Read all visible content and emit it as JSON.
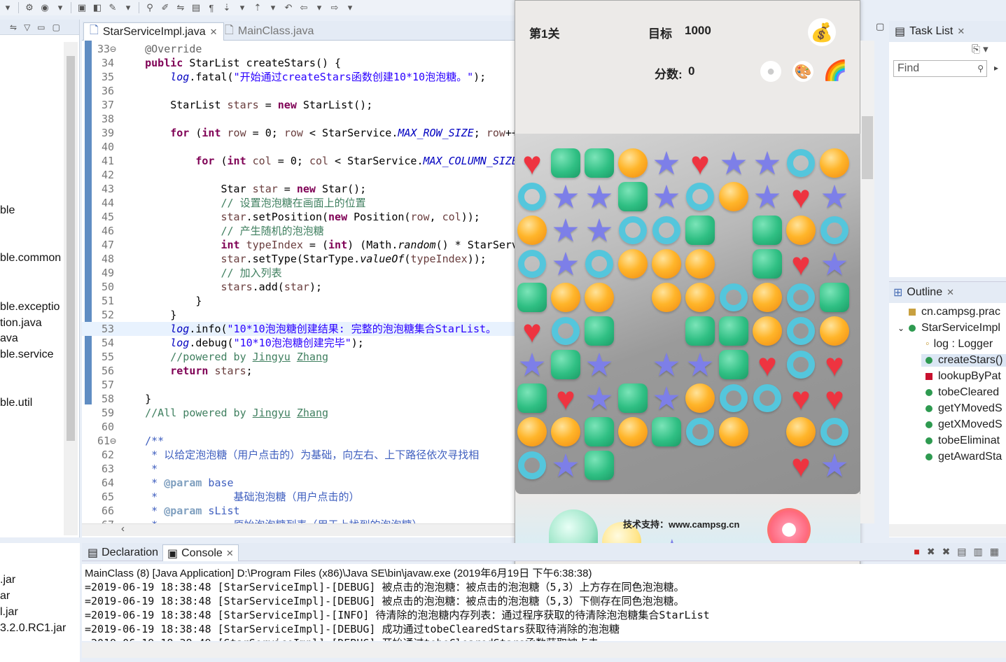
{
  "editor": {
    "tabs": [
      {
        "label": "StarServiceImpl.java",
        "active": true
      },
      {
        "label": "MainClass.java",
        "active": false
      }
    ]
  },
  "left_pane": {
    "items": [
      "ble",
      "ble.common",
      "ble.exceptio",
      "tion.java",
      "ava",
      "ble.service",
      "ble.util",
      ".jar",
      "ar",
      "l.jar",
      "3.2.0.RC1.jar"
    ]
  },
  "game": {
    "level_label": "第1关",
    "target_label": "目标",
    "target_value": "1000",
    "score_label": "分数:",
    "score_value": "0",
    "footer_text": "技术支持：www.campsg.cn",
    "board": [
      [
        "heart",
        "square",
        "square",
        "ball",
        "star",
        "heart",
        "star",
        "star",
        "ring",
        "ball"
      ],
      [
        "ring",
        "star",
        "star",
        "square",
        "star",
        "ring",
        "ball",
        "star",
        "heart",
        "star"
      ],
      [
        "ball",
        "star",
        "star",
        "ring",
        "ring",
        "square",
        "",
        "square",
        "ball",
        "ring"
      ],
      [
        "ring",
        "star",
        "ring",
        "ball",
        "ball",
        "ball",
        "",
        "square",
        "heart",
        "star"
      ],
      [
        "square",
        "ball",
        "ball",
        "",
        "ball",
        "ball",
        "ring",
        "ball",
        "ring",
        "square"
      ],
      [
        "heart",
        "ring",
        "square",
        "",
        "",
        "square",
        "square",
        "ball",
        "ring",
        "ball"
      ],
      [
        "star",
        "square",
        "star",
        "",
        "star",
        "star",
        "square",
        "heart",
        "ring",
        "heart"
      ],
      [
        "square",
        "heart",
        "star",
        "square",
        "star",
        "ball",
        "ring",
        "ring",
        "heart",
        "heart"
      ],
      [
        "ball",
        "ball",
        "square",
        "ball",
        "square",
        "ring",
        "ball",
        "",
        "ball",
        "ring"
      ],
      [
        "ring",
        "star",
        "square",
        "",
        "",
        "",
        "",
        "",
        "heart",
        "star"
      ]
    ]
  },
  "right": {
    "task_list_label": "Task List",
    "find_placeholder": "Find",
    "outline_label": "Outline",
    "outline_items": [
      {
        "label": "cn.campsg.prac",
        "kind": "package"
      },
      {
        "label": "StarServiceImpl",
        "kind": "class"
      },
      {
        "label": "log : Logger",
        "kind": "field"
      },
      {
        "label": "createStars()",
        "kind": "method",
        "selected": true
      },
      {
        "label": "lookupByPat",
        "kind": "private"
      },
      {
        "label": "tobeCleared",
        "kind": "method"
      },
      {
        "label": "getYMovedS",
        "kind": "method"
      },
      {
        "label": "getXMovedS",
        "kind": "method"
      },
      {
        "label": "tobeEliminat",
        "kind": "method"
      },
      {
        "label": "getAwardSta",
        "kind": "method"
      }
    ]
  },
  "console": {
    "tabs": [
      {
        "label": "Declaration",
        "active": false
      },
      {
        "label": "Console",
        "active": true
      }
    ],
    "header": "MainClass (8) [Java Application] D:\\Program Files (x86)\\Java SE\\bin\\javaw.exe (2019年6月19日 下午6:38:38)",
    "lines": [
      "=2019-06-19 18:38:48 [StarServiceImpl]-[DEBUG] 被点击的泡泡糖：被点击的泡泡糖（5,3）上方存在同色泡泡糖。",
      "=2019-06-19 18:38:48 [StarServiceImpl]-[DEBUG] 被点击的泡泡糖：被点击的泡泡糖（5,3）下侧存在同色泡泡糖。",
      "=2019-06-19 18:38:48 [StarServiceImpl]-[INFO] 待清除的泡泡糖内存列表：通过程序获取的待清除泡泡糖集合StarList",
      "=2019-06-19 18:38:48 [StarServiceImpl]-[DEBUG] 成功通过tobeClearedStars获取待消除的泡泡糖",
      "=2019-06-19 18:38:49 [StarServiceImpl]-[DEBUG] 开始通过tobeClearedStars函数获取被点击"
    ]
  }
}
